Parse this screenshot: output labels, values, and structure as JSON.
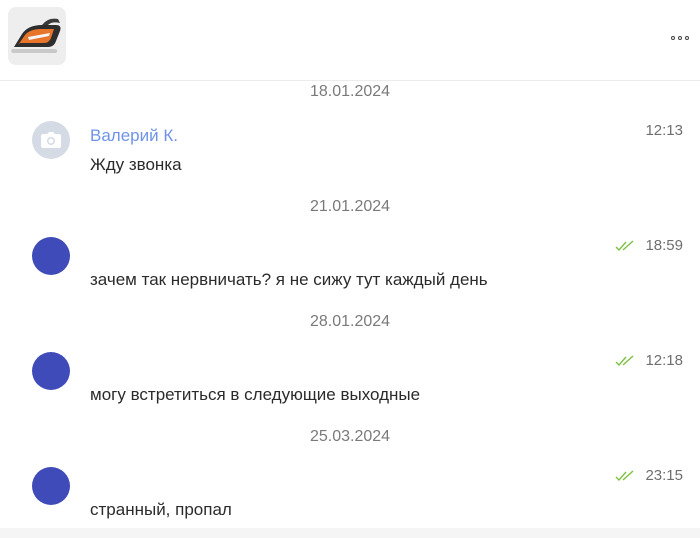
{
  "header": {
    "product_icon": "clothes-iron-image",
    "more_icon": "more-dots-icon"
  },
  "messages": [
    {
      "date": "18.01.2024",
      "sender": "Валерий К.",
      "avatar": "camera-placeholder-icon",
      "time": "12:13",
      "text": "Жду звонка",
      "read": false
    },
    {
      "date": "21.01.2024",
      "sender": "",
      "avatar": "avatar-blue",
      "time": "18:59",
      "text": "зачем так нервничать? я не сижу тут каждый день",
      "read": true
    },
    {
      "date": "28.01.2024",
      "sender": "",
      "avatar": "avatar-blue",
      "time": "12:18",
      "text": "могу встретиться в следующие выходные",
      "read": true
    },
    {
      "date": "25.03.2024",
      "sender": "",
      "avatar": "avatar-blue",
      "time": "23:15",
      "text": "странный, пропал",
      "read": true
    }
  ],
  "colors": {
    "sender_name": "#6f93e8",
    "avatar": "#3f4bb8",
    "read_check": "#7cc142"
  }
}
